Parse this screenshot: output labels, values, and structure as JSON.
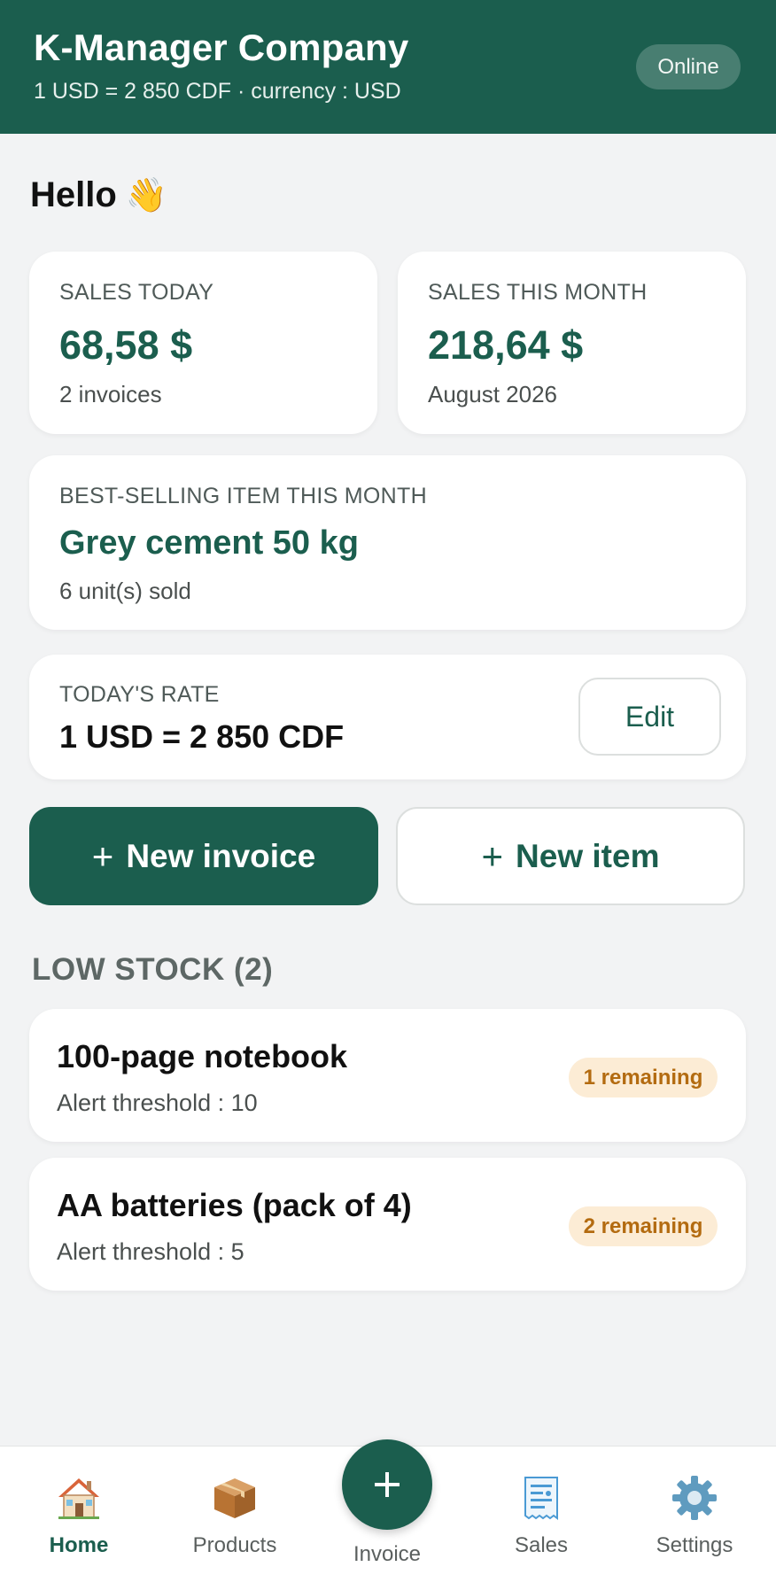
{
  "header": {
    "title": "K-Manager Company",
    "subtitle": "1 USD = 2 850 CDF · currency : USD",
    "status": "Online"
  },
  "greeting": {
    "text": "Hello",
    "emoji": "👋"
  },
  "stats": {
    "today": {
      "label": "SALES TODAY",
      "value": "68,58 $",
      "sub": "2 invoices"
    },
    "month": {
      "label": "SALES THIS MONTH",
      "value": "218,64 $",
      "sub": "August 2026"
    }
  },
  "best_seller": {
    "label": "BEST-SELLING ITEM THIS MONTH",
    "name": "Grey cement 50 kg",
    "sub": "6 unit(s) sold"
  },
  "rate": {
    "label": "TODAY'S RATE",
    "value": "1 USD = 2 850 CDF",
    "edit_label": "Edit"
  },
  "actions": {
    "new_invoice": "New invoice",
    "new_item": "New item",
    "plus": "+"
  },
  "low_stock": {
    "title": "LOW STOCK (2)",
    "items": [
      {
        "name": "100-page notebook",
        "threshold": "Alert threshold : 10",
        "badge": "1 remaining"
      },
      {
        "name": "AA batteries (pack of 4)",
        "threshold": "Alert threshold : 5",
        "badge": "2 remaining"
      }
    ]
  },
  "nav": {
    "home": "Home",
    "products": "Products",
    "invoice": "Invoice",
    "sales": "Sales",
    "settings": "Settings",
    "icons": [
      "home-icon",
      "package-icon",
      "plus-icon",
      "receipt-icon",
      "gear-icon"
    ]
  },
  "colors": {
    "primary": "#1b5e4e",
    "background": "#f2f3f4",
    "badge_bg": "#fcecd5",
    "badge_text": "#b36b10"
  }
}
